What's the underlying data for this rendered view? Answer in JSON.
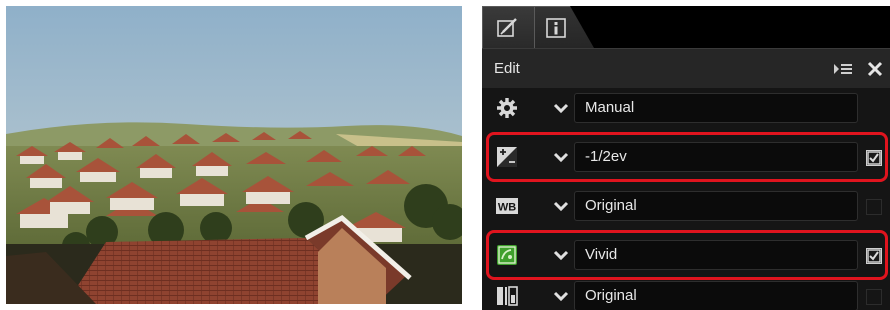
{
  "photo": {
    "alt": "hillside town with red roofs"
  },
  "panel": {
    "tabs": [
      {
        "name": "edit-tab",
        "icon": "edit-icon"
      },
      {
        "name": "info-tab",
        "icon": "info-icon"
      }
    ],
    "header": {
      "title": "Edit",
      "menu_icon": "panel-menu-icon",
      "close_icon": "close-icon"
    },
    "rows": [
      {
        "icon": "gear-icon",
        "value": "Manual",
        "checked": null
      },
      {
        "icon": "exposure-compensation-icon",
        "value": "-1/2ev",
        "checked": true,
        "highlighted": true
      },
      {
        "icon": "white-balance-icon",
        "icon_text": "WB",
        "value": "Original",
        "checked": false
      },
      {
        "icon": "picture-control-icon",
        "value": "Vivid",
        "checked": true,
        "highlighted": true
      },
      {
        "icon": "active-d-lighting-icon",
        "value": "Original",
        "checked": false
      }
    ]
  },
  "colors": {
    "highlight": "#e0141e",
    "panel_bg": "#151515",
    "field_bg": "#0b0b0b",
    "sky": "#a9c3d6",
    "roof": "#9a4a33"
  }
}
